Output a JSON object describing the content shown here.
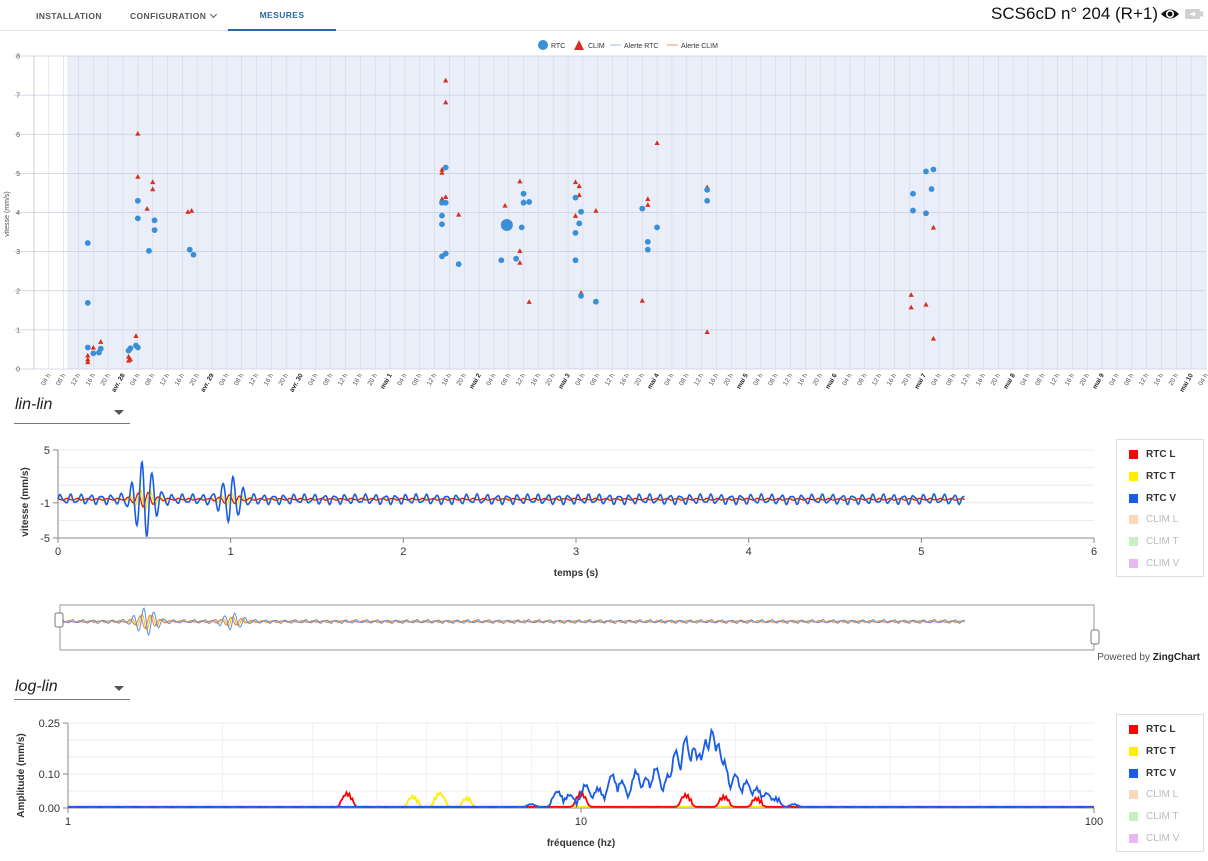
{
  "nav": {
    "tabs": [
      {
        "label": "INSTALLATION"
      },
      {
        "label": "CONFIGURATION"
      },
      {
        "label": "MESURES"
      }
    ],
    "device_title": "SCS6cD n° 204 (R+1)"
  },
  "colors": {
    "accent": "#2a6aa3",
    "rtc": "#3a8fd6",
    "clim": "#d8301e",
    "plot_bg": "#e9eef9",
    "rtc_l": "#ff0000",
    "rtc_t": "#ffee00",
    "rtc_v": "#1a5ce8",
    "clim_l": "#fbd9b8",
    "clim_t": "#c6f0c0",
    "clim_v": "#e8b8f2"
  },
  "icons": {
    "visibility": "eye-icon",
    "battery": "battery-icon",
    "dropdown": "caret-down-icon"
  },
  "time_select": {
    "value": "lin-lin"
  },
  "freq_select": {
    "value": "log-lin"
  },
  "powered_by": {
    "prefix": "Powered by",
    "brand": "ZingChart"
  },
  "chart_data": [
    {
      "type": "scatter",
      "legend": [
        "RTC",
        "CLIM",
        "Alerte RTC",
        "Alerte CLIM"
      ],
      "legend_position": "top-center",
      "ylabel": "vitesse (mm/s)",
      "ylim": [
        0,
        8
      ],
      "yticks": [
        0,
        1,
        2,
        3,
        4,
        5,
        6,
        7,
        8
      ],
      "x_hours_range": [
        0,
        316
      ],
      "x_tick_step_hours": 4,
      "x_tick_start_hour": 4,
      "x_tick_label_cycle": [
        "04 h",
        "08 h",
        "12 h",
        "16 h",
        "20 h",
        "DAY"
      ],
      "x_day_labels": [
        "avr. 28",
        "avr. 29",
        "avr. 30",
        "mai 1",
        "mai 2",
        "mai 3",
        "mai 4",
        "mai 5",
        "mai 6",
        "mai 7",
        "mai 8",
        "mai 9",
        "mai 10"
      ],
      "shaded_from_hour": 9,
      "grid": true,
      "series": [
        {
          "name": "RTC",
          "points": [
            [
              14.5,
              3.22
            ],
            [
              14.5,
              1.69
            ],
            [
              14.5,
              0.55
            ],
            [
              16,
              0.4
            ],
            [
              17.5,
              0.42
            ],
            [
              18,
              0.52
            ],
            [
              25.5,
              0.47
            ],
            [
              26,
              0.53
            ],
            [
              27.5,
              0.6
            ],
            [
              28,
              0.55
            ],
            [
              28,
              4.3
            ],
            [
              28,
              3.85
            ],
            [
              31,
              3.02
            ],
            [
              32.5,
              3.8
            ],
            [
              32.5,
              3.55
            ],
            [
              42,
              3.05
            ],
            [
              43,
              2.92
            ],
            [
              110,
              4.25
            ],
            [
              110,
              3.92
            ],
            [
              110,
              3.7
            ],
            [
              110,
              2.88
            ],
            [
              111,
              2.95
            ],
            [
              111,
              4.25
            ],
            [
              111,
              5.15
            ],
            [
              114.5,
              2.68
            ],
            [
              126,
              2.78
            ],
            [
              130,
              2.82
            ],
            [
              131.5,
              3.62
            ],
            [
              132,
              4.25
            ],
            [
              132,
              4.48
            ],
            [
              133.5,
              4.27
            ],
            [
              146,
              4.38
            ],
            [
              146,
              3.48
            ],
            [
              146,
              2.78
            ],
            [
              147,
              3.72
            ],
            [
              147.5,
              4.02
            ],
            [
              147.5,
              1.87
            ],
            [
              151.5,
              1.72
            ],
            [
              164,
              4.1
            ],
            [
              165.5,
              3.25
            ],
            [
              165.5,
              3.05
            ],
            [
              168,
              3.62
            ],
            [
              181.5,
              4.58
            ],
            [
              181.5,
              4.3
            ],
            [
              237,
              4.48
            ],
            [
              237,
              4.05
            ],
            [
              240.5,
              3.98
            ],
            [
              240.5,
              5.05
            ],
            [
              242,
              4.6
            ],
            [
              242.5,
              5.1
            ]
          ]
        },
        {
          "name": "CLIM",
          "points": [
            [
              14.5,
              0.35
            ],
            [
              14.5,
              0.25
            ],
            [
              14.5,
              0.18
            ],
            [
              16,
              0.55
            ],
            [
              18,
              0.7
            ],
            [
              25.5,
              0.32
            ],
            [
              25.5,
              0.22
            ],
            [
              26,
              0.25
            ],
            [
              27.5,
              0.85
            ],
            [
              28,
              6.02
            ],
            [
              28,
              4.92
            ],
            [
              30.5,
              4.1
            ],
            [
              32,
              4.78
            ],
            [
              32,
              4.6
            ],
            [
              41.5,
              4.02
            ],
            [
              42.5,
              4.05
            ],
            [
              110,
              5.1
            ],
            [
              110,
              5.02
            ],
            [
              110,
              4.35
            ],
            [
              111,
              7.38
            ],
            [
              111,
              6.82
            ],
            [
              111,
              4.4
            ],
            [
              114.5,
              3.95
            ],
            [
              127,
              4.18
            ],
            [
              131,
              4.8
            ],
            [
              131,
              3.02
            ],
            [
              131,
              2.72
            ],
            [
              132,
              4.28
            ],
            [
              133.5,
              1.72
            ],
            [
              146,
              4.78
            ],
            [
              146,
              3.92
            ],
            [
              147,
              4.68
            ],
            [
              147,
              4.45
            ],
            [
              147.5,
              1.95
            ],
            [
              151.5,
              4.05
            ],
            [
              164,
              1.75
            ],
            [
              165.5,
              4.35
            ],
            [
              165.5,
              4.2
            ],
            [
              168,
              5.78
            ],
            [
              181.5,
              4.65
            ],
            [
              181.5,
              0.95
            ],
            [
              236.5,
              1.9
            ],
            [
              236.5,
              1.58
            ],
            [
              240.5,
              1.65
            ],
            [
              242.5,
              3.62
            ],
            [
              242.5,
              0.78
            ]
          ]
        }
      ],
      "highlight_point": {
        "series": "RTC",
        "x": 127.5,
        "y": 3.68
      }
    },
    {
      "type": "line",
      "xlabel": "temps (s)",
      "ylabel": "vitesse (mm/s)",
      "xlim": [
        0,
        6
      ],
      "ylim": [
        -5,
        5
      ],
      "xticks": [
        0,
        1,
        2,
        3,
        4,
        5,
        6
      ],
      "yticks": [
        5,
        -1,
        -5
      ],
      "legend_position": "right",
      "series": [
        {
          "name": "RTC L",
          "active": true
        },
        {
          "name": "RTC T",
          "active": true
        },
        {
          "name": "RTC V",
          "active": true
        },
        {
          "name": "CLIM L",
          "active": false
        },
        {
          "name": "CLIM T",
          "active": false
        },
        {
          "name": "CLIM V",
          "active": false
        }
      ],
      "signal": {
        "duration_s": 5.25,
        "baseline": -0.6,
        "dominant_freq_hz": 17,
        "peak_amplitude_v": 3.9,
        "burst_times_s": [
          0.5,
          1.0
        ],
        "rtc_v_samples": [
          [
            0.0,
            -0.6
          ],
          [
            0.1,
            -0.4
          ],
          [
            0.2,
            -0.8
          ],
          [
            0.3,
            -0.5
          ],
          [
            0.4,
            1.8
          ],
          [
            0.45,
            -3.2
          ],
          [
            0.5,
            3.9
          ],
          [
            0.55,
            -4.2
          ],
          [
            0.6,
            2.0
          ],
          [
            0.7,
            -1.4
          ],
          [
            0.8,
            0.5
          ],
          [
            0.9,
            -1.6
          ],
          [
            1.0,
            1.8
          ],
          [
            1.05,
            -2.0
          ],
          [
            1.1,
            0.9
          ],
          [
            1.3,
            -0.9
          ],
          [
            1.6,
            -0.2
          ],
          [
            2.0,
            -0.9
          ],
          [
            2.5,
            -0.3
          ],
          [
            3.0,
            -0.9
          ],
          [
            3.5,
            -0.4
          ],
          [
            4.0,
            -0.8
          ],
          [
            4.5,
            -0.4
          ],
          [
            5.0,
            -0.8
          ],
          [
            5.25,
            -0.6
          ]
        ],
        "rtc_l_amplitude": 0.2,
        "rtc_t_amplitude": 0.3
      }
    },
    {
      "type": "line",
      "scale_x": "log",
      "xlabel": "fréquence (hz)",
      "ylabel": "Amplitude (mm/s)",
      "xlim": [
        1,
        100
      ],
      "ylim": [
        0,
        0.25
      ],
      "xticks": [
        1,
        10,
        100
      ],
      "yticks": [
        0.25,
        0.1,
        0.0
      ],
      "legend_position": "right",
      "series": [
        {
          "name": "RTC L",
          "active": true,
          "peaks": [
            [
              3.5,
              0.035
            ],
            [
              10,
              0.035
            ],
            [
              16,
              0.03
            ],
            [
              19,
              0.025
            ],
            [
              22,
              0.02
            ]
          ]
        },
        {
          "name": "RTC T",
          "active": true,
          "peaks": [
            [
              4.7,
              0.025
            ],
            [
              5.3,
              0.035
            ],
            [
              6,
              0.02
            ]
          ]
        },
        {
          "name": "RTC V",
          "active": true,
          "peaks": [
            [
              8,
              0.01
            ],
            [
              9,
              0.04
            ],
            [
              9.5,
              0.03
            ],
            [
              10.2,
              0.06
            ],
            [
              10.8,
              0.05
            ],
            [
              11.5,
              0.09
            ],
            [
              12,
              0.07
            ],
            [
              12.8,
              0.1
            ],
            [
              13.4,
              0.08
            ],
            [
              14,
              0.11
            ],
            [
              14.8,
              0.09
            ],
            [
              15.3,
              0.16
            ],
            [
              16,
              0.2
            ],
            [
              16.6,
              0.17
            ],
            [
              17,
              0.15
            ],
            [
              17.5,
              0.19
            ],
            [
              18,
              0.22
            ],
            [
              18.5,
              0.18
            ],
            [
              19,
              0.13
            ],
            [
              20,
              0.09
            ],
            [
              21,
              0.07
            ],
            [
              22,
              0.05
            ],
            [
              23,
              0.035
            ],
            [
              24,
              0.02
            ],
            [
              26,
              0.01
            ]
          ]
        },
        {
          "name": "CLIM L",
          "active": false
        },
        {
          "name": "CLIM T",
          "active": false
        },
        {
          "name": "CLIM V",
          "active": false
        }
      ]
    }
  ]
}
